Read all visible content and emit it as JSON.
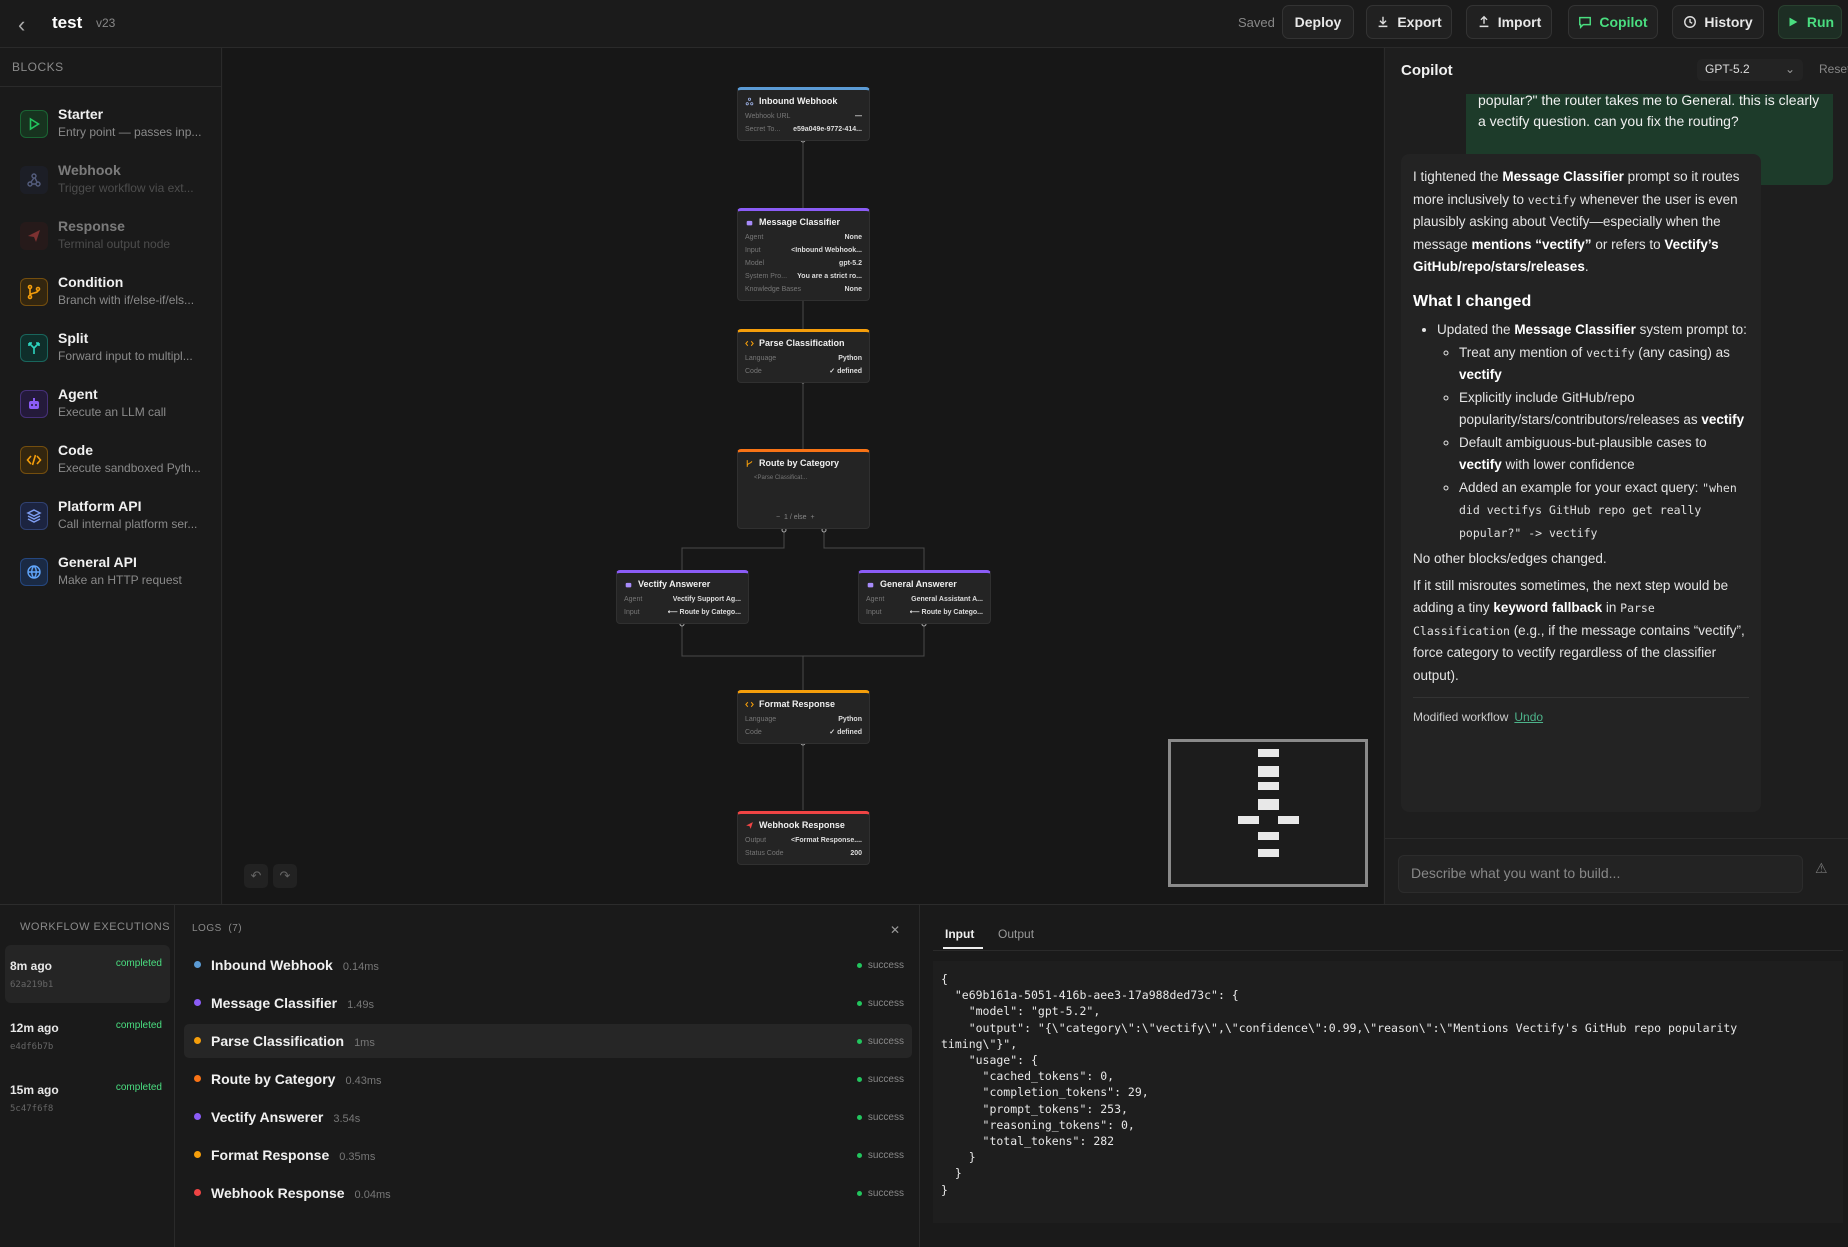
{
  "header": {
    "title": "test",
    "version": "v23",
    "saved": "Saved",
    "buttons": {
      "deploy": "Deploy",
      "export": "Export",
      "import": "Import",
      "copilot": "Copilot",
      "history": "History",
      "run": "Run"
    }
  },
  "sidebar": {
    "heading": "BLOCKS",
    "items": [
      {
        "name": "Starter",
        "desc": "Entry point — passes inp...",
        "color": "#22c55e"
      },
      {
        "name": "Webhook",
        "desc": "Trigger workflow via ext...",
        "color": "#6b7ab5"
      },
      {
        "name": "Response",
        "desc": "Terminal output node",
        "color": "#e04848"
      },
      {
        "name": "Condition",
        "desc": "Branch with if/else-if/els...",
        "color": "#f59e0b"
      },
      {
        "name": "Split",
        "desc": "Forward input to multipl...",
        "color": "#2dd4bf"
      },
      {
        "name": "Agent",
        "desc": "Execute an LLM call",
        "color": "#8b5cf6"
      },
      {
        "name": "Code",
        "desc": "Execute sandboxed Pyth...",
        "color": "#f59e0b"
      },
      {
        "name": "Platform API",
        "desc": "Call internal platform ser...",
        "color": "#5b7bd5"
      },
      {
        "name": "General API",
        "desc": "Make an HTTP request",
        "color": "#3b82f6"
      }
    ]
  },
  "canvas": {
    "nodes": {
      "inbound": {
        "title": "Inbound Webhook",
        "r1k": "Webhook URL",
        "r1v": "—",
        "r2k": "Secret To...",
        "r2v": "e59a049e-9772-414..."
      },
      "classifier": {
        "title": "Message Classifier",
        "r1k": "Agent",
        "r1v": "None",
        "r2k": "Input",
        "r2v": "<Inbound Webhook...",
        "r3k": "Model",
        "r3v": "gpt-5.2",
        "r4k": "System Pro...",
        "r4v": "You are a strict ro...",
        "r5k": "Knowledge Bases",
        "r5v": "None"
      },
      "parse": {
        "title": "Parse Classification",
        "r1k": "Language",
        "r1v": "Python",
        "r2k": "Code",
        "r2v": "✓ defined"
      },
      "route": {
        "title": "Route by Category",
        "cond": "<Parse Classificat...",
        "ctrl": "1 / else"
      },
      "vectify": {
        "title": "Vectify Answerer",
        "r1k": "Agent",
        "r1v": "Vectify Support Ag...",
        "r2k": "Input",
        "r2v": "⟵ Route by Catego..."
      },
      "general": {
        "title": "General Answerer",
        "r1k": "Agent",
        "r1v": "General Assistant A...",
        "r2k": "Input",
        "r2v": "⟵ Route by Catego..."
      },
      "format": {
        "title": "Format Response",
        "r1k": "Language",
        "r1v": "Python",
        "r2k": "Code",
        "r2v": "✓ defined"
      },
      "response": {
        "title": "Webhook Response",
        "r1k": "Output",
        "r1v": "<Format Response....",
        "r2k": "Status Code",
        "r2v": "200"
      }
    }
  },
  "copilot": {
    "title": "Copilot",
    "model": "GPT-5.2",
    "reset": "Reset",
    "user_message": "popular?\" the router takes me to General. this is clearly a vectify question. can you fix the routing?",
    "reply": {
      "p1_a": "I tightened the ",
      "p1_b": "Message Classifier",
      "p1_c": " prompt so it routes more inclusively to ",
      "p1_code": "vectify",
      "p1_d": " whenever the user is even plausibly asking about Vectify—especially when the message ",
      "p1_e": "mentions “vectify”",
      "p1_f": " or refers to ",
      "p1_g": "Vectify’s GitHub/repo/stars/releases",
      "p1_h": ".",
      "heading": "What I changed",
      "b1_a": "Updated the ",
      "b1_b": "Message Classifier",
      "b1_c": " system prompt to:",
      "s1_a": "Treat any mention of ",
      "s1_code": "vectify",
      "s1_b": " (any casing) as ",
      "s1_c": "vectify",
      "s2_a": "Explicitly include GitHub/repo popularity/stars/contributors/releases as ",
      "s2_b": "vectify",
      "s3_a": "Default ambiguous-but-plausible cases to ",
      "s3_b": "vectify",
      "s3_c": " with lower confidence",
      "s4_a": "Added an example for your exact query: ",
      "s4_code": "\"when did vectifys GitHub repo get really popular?\" -> vectify",
      "p2": "No other blocks/edges changed.",
      "p3_a": "If it still misroutes sometimes, the next step would be adding a tiny ",
      "p3_b": "keyword fallback",
      "p3_c": " in ",
      "p3_code": "Parse Classification",
      "p3_d": " (e.g., if the message contains “vectify”, force category to vectify regardless of the classifier output).",
      "modified": "Modified workflow",
      "undo": "Undo"
    },
    "input_placeholder": "Describe what you want to build..."
  },
  "executions": {
    "heading": "WORKFLOW EXECUTIONS",
    "items": [
      {
        "time": "8m ago",
        "status": "completed",
        "id": "62a219b1"
      },
      {
        "time": "12m ago",
        "status": "completed",
        "id": "e4df6b7b"
      },
      {
        "time": "15m ago",
        "status": "completed",
        "id": "5c47f6f8"
      }
    ]
  },
  "logs": {
    "heading": "LOGS",
    "count": "(7)",
    "items": [
      {
        "name": "Inbound Webhook",
        "time": "0.14ms",
        "status": "success",
        "color": "#5b9bd5"
      },
      {
        "name": "Message Classifier",
        "time": "1.49s",
        "status": "success",
        "color": "#8b5cf6"
      },
      {
        "name": "Parse Classification",
        "time": "1ms",
        "status": "success",
        "color": "#f59e0b"
      },
      {
        "name": "Route by Category",
        "time": "0.43ms",
        "status": "success",
        "color": "#f97316"
      },
      {
        "name": "Vectify Answerer",
        "time": "3.54s",
        "status": "success",
        "color": "#8b5cf6"
      },
      {
        "name": "Format Response",
        "time": "0.35ms",
        "status": "success",
        "color": "#f59e0b"
      },
      {
        "name": "Webhook Response",
        "time": "0.04ms",
        "status": "success",
        "color": "#ef4444"
      }
    ]
  },
  "io": {
    "tab_input": "Input",
    "tab_output": "Output",
    "json": "{\n  \"e69b161a-5051-416b-aee3-17a988ded73c\": {\n    \"model\": \"gpt-5.2\",\n    \"output\": \"{\\\"category\\\":\\\"vectify\\\",\\\"confidence\\\":0.99,\\\"reason\\\":\\\"Mentions Vectify's GitHub repo popularity\ntiming\\\"}\",\n    \"usage\": {\n      \"cached_tokens\": 0,\n      \"completion_tokens\": 29,\n      \"prompt_tokens\": 253,\n      \"reasoning_tokens\": 0,\n      \"total_tokens\": 282\n    }\n  }\n}"
  }
}
